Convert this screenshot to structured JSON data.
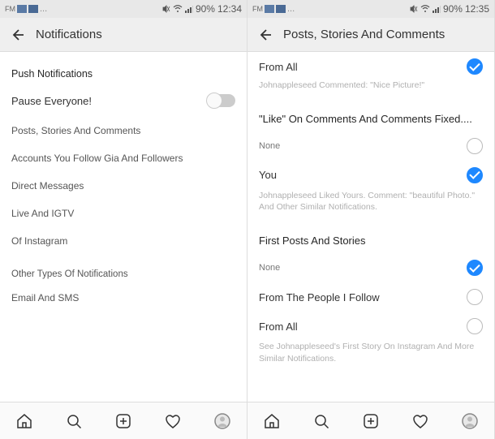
{
  "left": {
    "status": {
      "fm": "FM",
      "dots": "...",
      "battery": "90%",
      "time": "12:34"
    },
    "header": {
      "title": "Notifications"
    },
    "sections": {
      "push": "Push Notifications",
      "pause": "Pause Everyone!",
      "posts": "Posts, Stories And Comments",
      "accounts": "Accounts You Follow Gia And Followers",
      "dm": "Direct Messages",
      "live": "Live And IGTV",
      "of": "Of Instagram",
      "other_head": "Other Types Of Notifications",
      "email": "Email And SMS"
    }
  },
  "right": {
    "status": {
      "fm": "FM",
      "dots": "...",
      "battery": "90%",
      "time": "12:35"
    },
    "header": {
      "title": "Posts, Stories And Comments"
    },
    "from_all": "From All",
    "caption1": "Johnappleseed Commented: \"Nice Picture!\"",
    "like_title": "\"Like\" On Comments And Comments Fixed....",
    "none": "None",
    "you": "You",
    "caption2": "Johnappleseed Liked Yours. Comment: \"beautiful Photo.\" And Other Similar Notifications.",
    "first_posts": "First Posts And Stories",
    "none2": "None",
    "from_follow": "From The People I Follow",
    "from_all2": "From All",
    "caption3": "See Johnappleseed's First Story On Instagram And More Similar Notifications."
  }
}
